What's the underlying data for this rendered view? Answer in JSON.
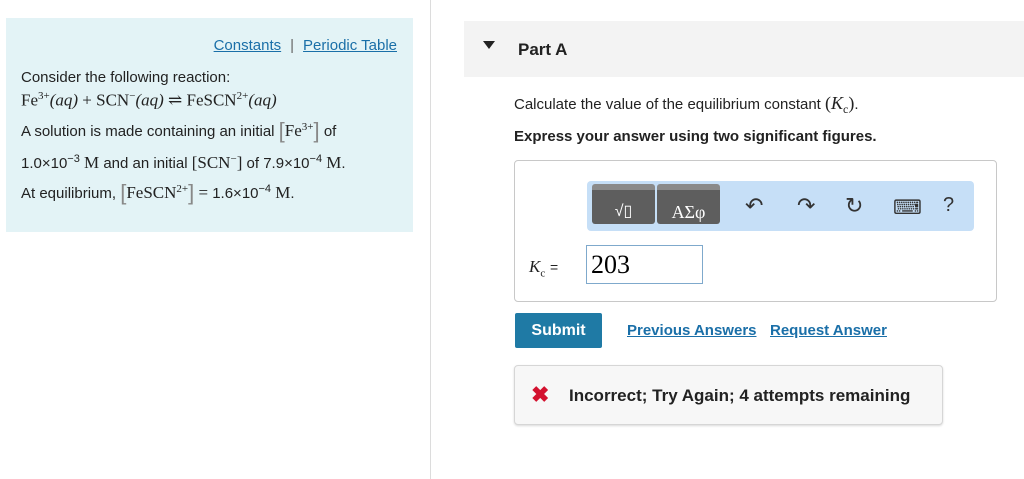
{
  "resources": {
    "constants": "Constants",
    "separator": "|",
    "periodic_table": "Periodic Table"
  },
  "problem": {
    "intro": "Consider the following reaction:",
    "reaction": {
      "fe": "Fe",
      "fe_charge": "3+",
      "aq1": "(aq)",
      "plus": "+",
      "scn": "SCN",
      "scn_charge": "−",
      "aq2": "(aq)",
      "arrow": "⇌",
      "product": "FeSCN",
      "product_charge": "2+",
      "aq3": "(aq)"
    },
    "line1": {
      "text": "A solution is made containing an initial",
      "species": "Fe",
      "charge": "3+",
      "of": "of"
    },
    "line2": {
      "value1_base": "1.0×10",
      "value1_exp": "−3",
      "unit1": "M",
      "middle": "and an initial",
      "species": "SCN",
      "charge": "−",
      "of": "of",
      "value2_base": "7.9×10",
      "value2_exp": "−4",
      "unit2": "M",
      "end": "."
    },
    "line3": {
      "text": "At equilibrium,",
      "species": "FeSCN",
      "charge": "2+",
      "equals": "=",
      "value_base": "1.6×10",
      "value_exp": "−4",
      "unit": "M",
      "end": "."
    }
  },
  "part": {
    "label": "Part A"
  },
  "question": {
    "text": "Calculate the value of the equilibrium constant",
    "symbol": "K",
    "sub": "c",
    "end": "."
  },
  "instruction": "Express your answer using two significant figures.",
  "toolbar": {
    "templates_icon": "√▯",
    "greek_label": "ΑΣφ",
    "undo": "↶",
    "redo": "↷",
    "reset": "↻",
    "keyboard": "⌨",
    "help": "?"
  },
  "answer": {
    "label_symbol": "K",
    "label_sub": "c",
    "equals": "=",
    "value": "203"
  },
  "actions": {
    "submit": "Submit",
    "previous_answers": "Previous Answers",
    "request_answer": "Request Answer"
  },
  "feedback": {
    "icon": "✖",
    "message": "Incorrect; Try Again; 4 attempts remaining",
    "color": "#d3122f"
  }
}
